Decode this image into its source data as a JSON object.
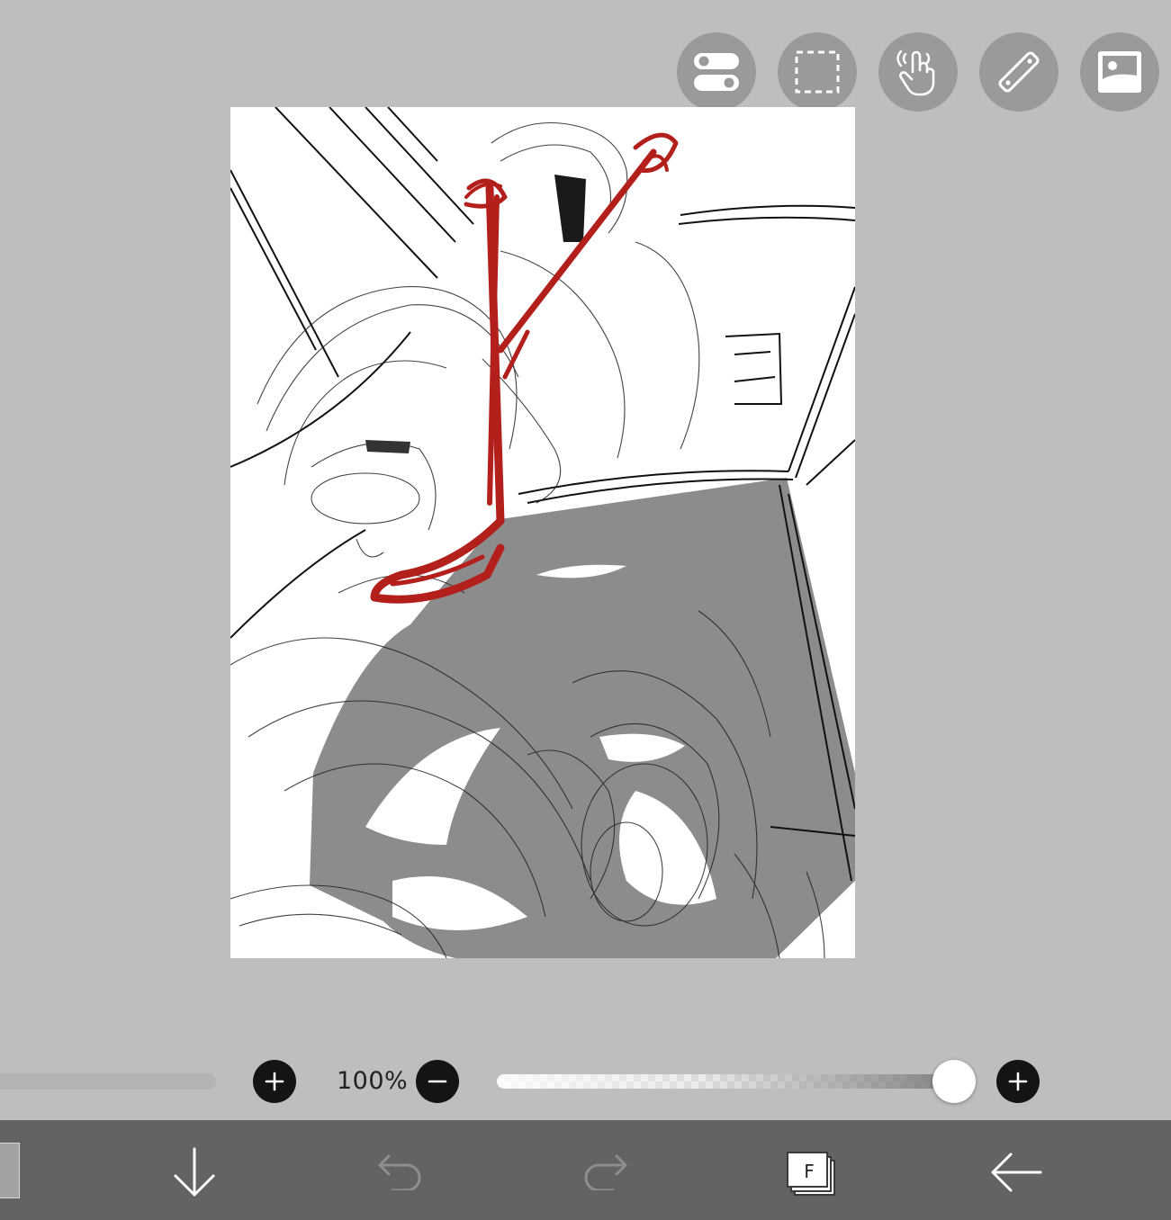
{
  "toolbar": {
    "buttons": [
      {
        "name": "toggle-icon"
      },
      {
        "name": "selection-icon"
      },
      {
        "name": "hand-gesture-icon"
      },
      {
        "name": "ruler-icon"
      },
      {
        "name": "image-icon"
      }
    ]
  },
  "canvas": {
    "accent_color": "#b3201c",
    "fill_color": "#8c8c8c"
  },
  "controls": {
    "zoom_label": "100%",
    "opacity_level": 0.96
  },
  "bottom_bar": {
    "layer_letter": "F",
    "icons": [
      "download-arrow-icon",
      "undo-icon",
      "redo-icon",
      "layers-icon",
      "back-arrow-icon"
    ]
  }
}
